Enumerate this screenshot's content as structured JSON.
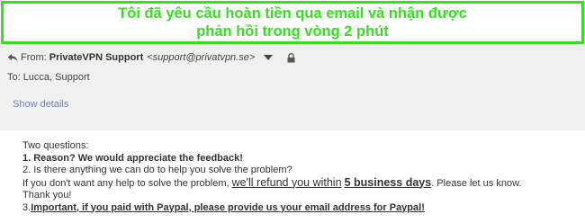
{
  "banner": {
    "line1": "Tôi đã yêu cầu hoàn tiền qua email và nhận được",
    "line2": "phản hồi trong vòng 2 phút"
  },
  "email_header": {
    "from_label": "From:",
    "from_name": "PrivateVPN Support",
    "from_email": "<support@privatvpn.se>",
    "to_label": "To:",
    "to_value": "Lucca, Support",
    "show_details": "Show details"
  },
  "email_body": {
    "intro": "Two questions:",
    "q1": "1. Reason? We would appreciate the feedback!",
    "q2": "2. Is there anything we can do to help you solve the problem?",
    "refund_prefix": "If you don't want any help to solve the problem,",
    "refund_underline": "we'll refund you within",
    "refund_bold": "5 business days",
    "refund_suffix": ". Please let us know.",
    "thanks": "Thank you!",
    "q3_number": "3.",
    "q3_text": "Important, if you paid with Paypal, please provide us your email address for Paypal!"
  },
  "colors": {
    "accent_green": "#35e01e",
    "header_bg": "#f0f0f0",
    "link": "#6f83b8"
  },
  "icons": [
    "reply-icon",
    "dropdown-caret-icon",
    "lock-icon"
  ]
}
